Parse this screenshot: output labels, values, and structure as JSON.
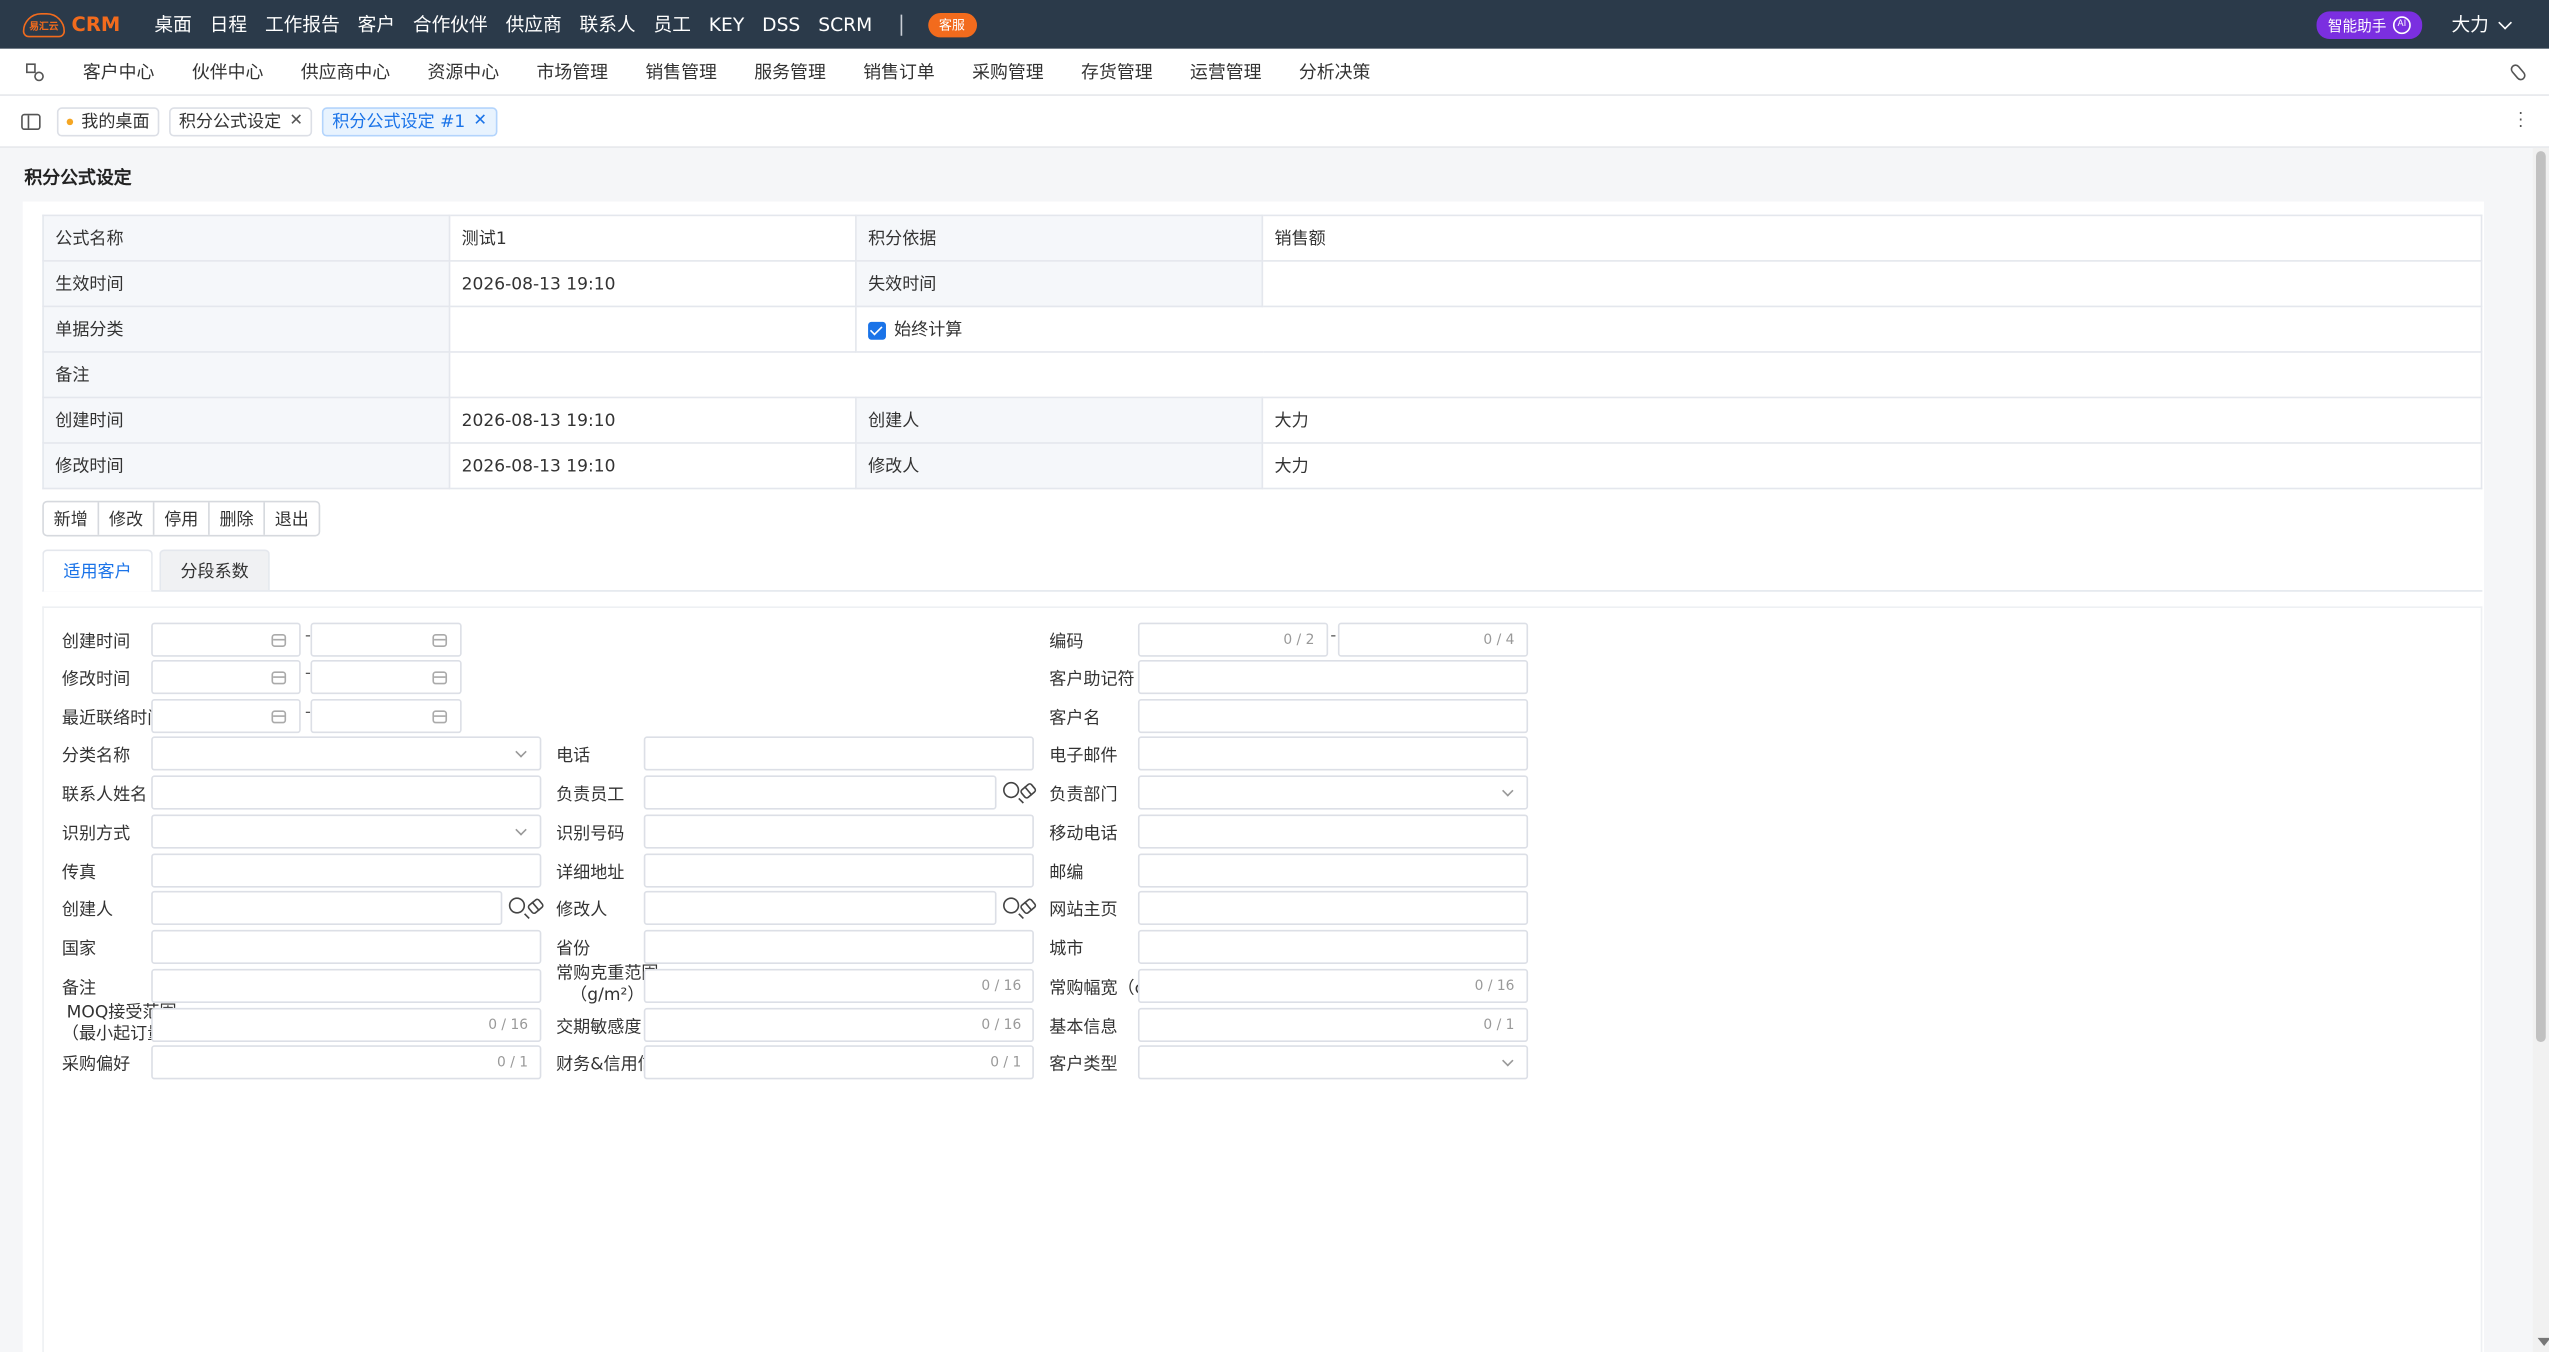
{
  "topbar": {
    "logo_mark": "易汇云",
    "logo_text": "CRM",
    "nav": [
      "桌面",
      "日程",
      "工作报告",
      "客户",
      "合作伙伴",
      "供应商",
      "联系人",
      "员工",
      "KEY",
      "DSS",
      "SCRM"
    ],
    "service_label": "客服",
    "ai_label": "智能助手",
    "ai_badge": "AI",
    "user": "大力"
  },
  "modules": [
    "客户中心",
    "伙伴中心",
    "供应商中心",
    "资源中心",
    "市场管理",
    "销售管理",
    "服务管理",
    "销售订单",
    "采购管理",
    "存货管理",
    "运营管理",
    "分析决策"
  ],
  "tabs": [
    {
      "label": "我的桌面"
    },
    {
      "label": "积分公式设定"
    },
    {
      "label": "积分公式设定 #1"
    }
  ],
  "page": {
    "title": "积分公式设定"
  },
  "info": {
    "formula_name_label": "公式名称",
    "formula_name": "测试1",
    "basis_label": "积分依据",
    "basis": "销售额",
    "effective_label": "生效时间",
    "effective": "2026-08-13 19:10",
    "expire_label": "失效时间",
    "expire": "",
    "category_label": "单据分类",
    "category": "",
    "always_label": "始终计算",
    "remark_label": "备注",
    "remark": "",
    "created_label": "创建时间",
    "created": "2026-08-13 19:10",
    "creator_label": "创建人",
    "creator": "大力",
    "modified_label": "修改时间",
    "modified": "2026-08-13 19:10",
    "modifier_label": "修改人",
    "modifier": "大力"
  },
  "actions": [
    "新增",
    "修改",
    "停用",
    "删除",
    "退出"
  ],
  "subtabs": [
    "适用客户",
    "分段系数"
  ],
  "form": {
    "created_time": "创建时间",
    "modified_time": "修改时间",
    "last_contact": "最近联络时间",
    "code": "编码",
    "code_cnt1": "0 / 2",
    "code_cnt2": "0 / 4",
    "mnemonic": "客户助记符",
    "customer_name": "客户名",
    "category_name": "分类名称",
    "phone": "电话",
    "email": "电子邮件",
    "contact_name": "联系人姓名",
    "owner": "负责员工",
    "dept": "负责部门",
    "id_method": "识别方式",
    "id_number": "识别号码",
    "mobile": "移动电话",
    "fax": "传真",
    "address": "详细地址",
    "zip": "邮编",
    "creator": "创建人",
    "modifier": "修改人",
    "website": "网站主页",
    "country": "国家",
    "province": "省份",
    "city": "城市",
    "remark": "备注",
    "weight_range_1": "常购克重范围",
    "weight_range_2": "（g/m²）",
    "weight_cnt": "0 / 16",
    "width_range": "常购幅宽（cm）",
    "width_cnt": "0 / 16",
    "moq_1": "MOQ接受范围",
    "moq_2": "（最小起订量）",
    "moq_cnt": "0 / 16",
    "lead_sens": "交期敏感度",
    "lead_cnt": "0 / 16",
    "basic_info": "基本信息",
    "basic_cnt": "0 / 1",
    "purchase_pref": "采购偏好",
    "purchase_cnt": "0 / 1",
    "finance": "财务&信用信息",
    "finance_cnt": "0 / 1",
    "customer_type": "客户类型"
  }
}
